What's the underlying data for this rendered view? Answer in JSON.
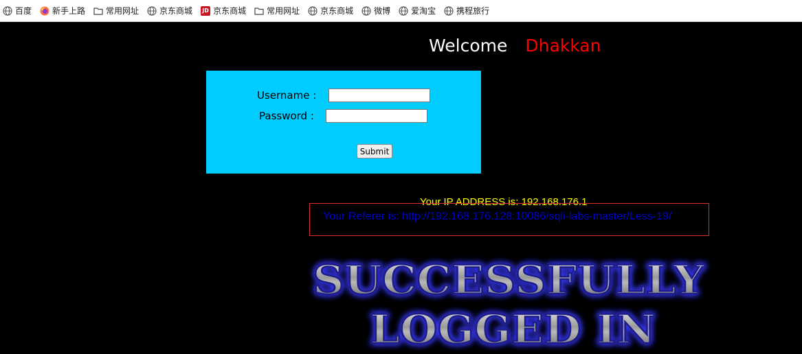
{
  "bookmarks": [
    {
      "label": "百度",
      "icon": "globe-icon"
    },
    {
      "label": "新手上路",
      "icon": "firefox-icon"
    },
    {
      "label": "常用网址",
      "icon": "folder-icon"
    },
    {
      "label": "京东商城",
      "icon": "globe-icon"
    },
    {
      "label": "京东商城",
      "icon": "jd-icon"
    },
    {
      "label": "常用网址",
      "icon": "folder-icon"
    },
    {
      "label": "京东商城",
      "icon": "globe-icon"
    },
    {
      "label": "微博",
      "icon": "globe-icon"
    },
    {
      "label": "爱淘宝",
      "icon": "globe-icon"
    },
    {
      "label": "携程旅行",
      "icon": "globe-icon"
    }
  ],
  "jd_badge": "JD",
  "welcome": {
    "text": "Welcome",
    "name": "Dhakkan",
    "name_color": "#ff0000"
  },
  "login": {
    "username_label": "Username :",
    "password_label": "Password :",
    "username_value": "",
    "password_value": "",
    "submit_label": "Submit",
    "box_color": "#00ccff"
  },
  "ip_text": "Your IP ADDRESS is: 192.168.176.1",
  "referer_text": "Your Referer is: http://192.168.176.128:10086/sqli-labs-master/Less-19/",
  "banner": {
    "line1": "SUCCESSFULLY",
    "line2": "LOGGED IN"
  },
  "colors": {
    "background": "#000000",
    "ip": "#ffff00",
    "referer": "#0000cc",
    "referer_border": "#e03030"
  }
}
